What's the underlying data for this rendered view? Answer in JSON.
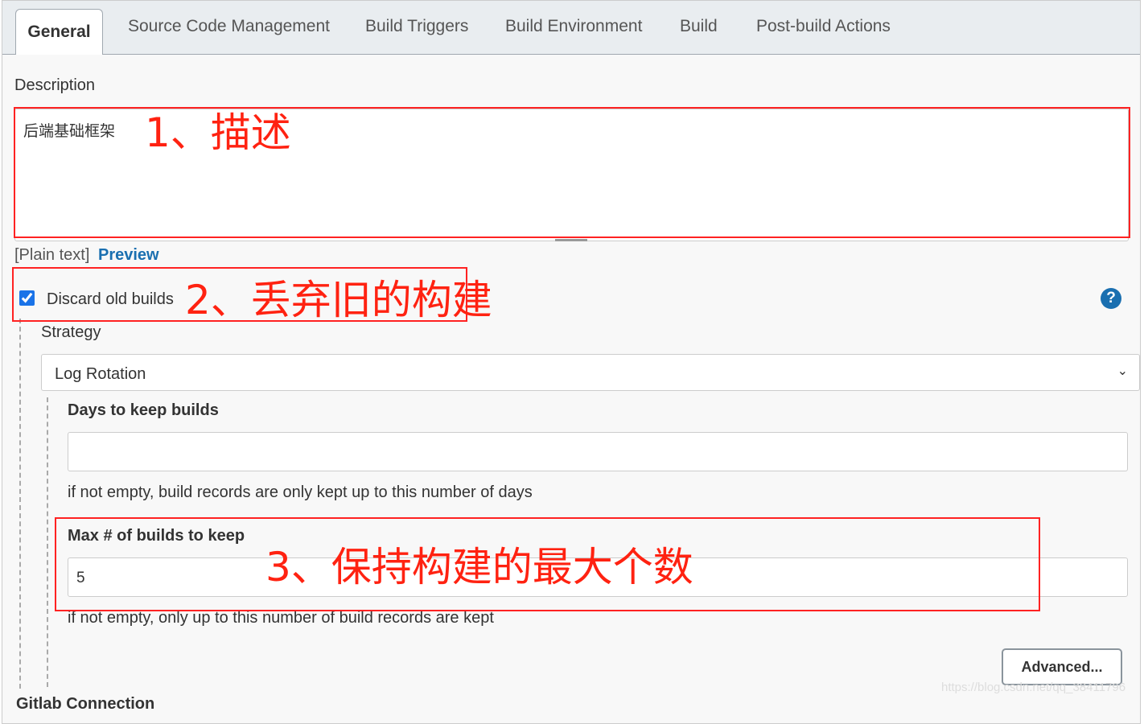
{
  "tabs": [
    "General",
    "Source Code Management",
    "Build Triggers",
    "Build Environment",
    "Build",
    "Post-build Actions"
  ],
  "description": {
    "label": "Description",
    "value": "后端基础框架",
    "plain_text": "[Plain text]",
    "preview": "Preview"
  },
  "discard": {
    "label": "Discard old builds",
    "checked": true,
    "help": "?"
  },
  "strategy": {
    "label": "Strategy",
    "value": "Log Rotation"
  },
  "days": {
    "label": "Days to keep builds",
    "value": "",
    "help": "if not empty, build records are only kept up to this number of days"
  },
  "max": {
    "label": "Max # of builds to keep",
    "value": "5",
    "help": "if not empty, only up to this number of build records are kept"
  },
  "advanced": "Advanced...",
  "next_section": "Gitlab Connection",
  "annotations": [
    "1、描述",
    "2、丢弃旧的构建",
    "3、保持构建的最大个数"
  ],
  "watermark": "https://blog.csdn.net/qq_38411796"
}
